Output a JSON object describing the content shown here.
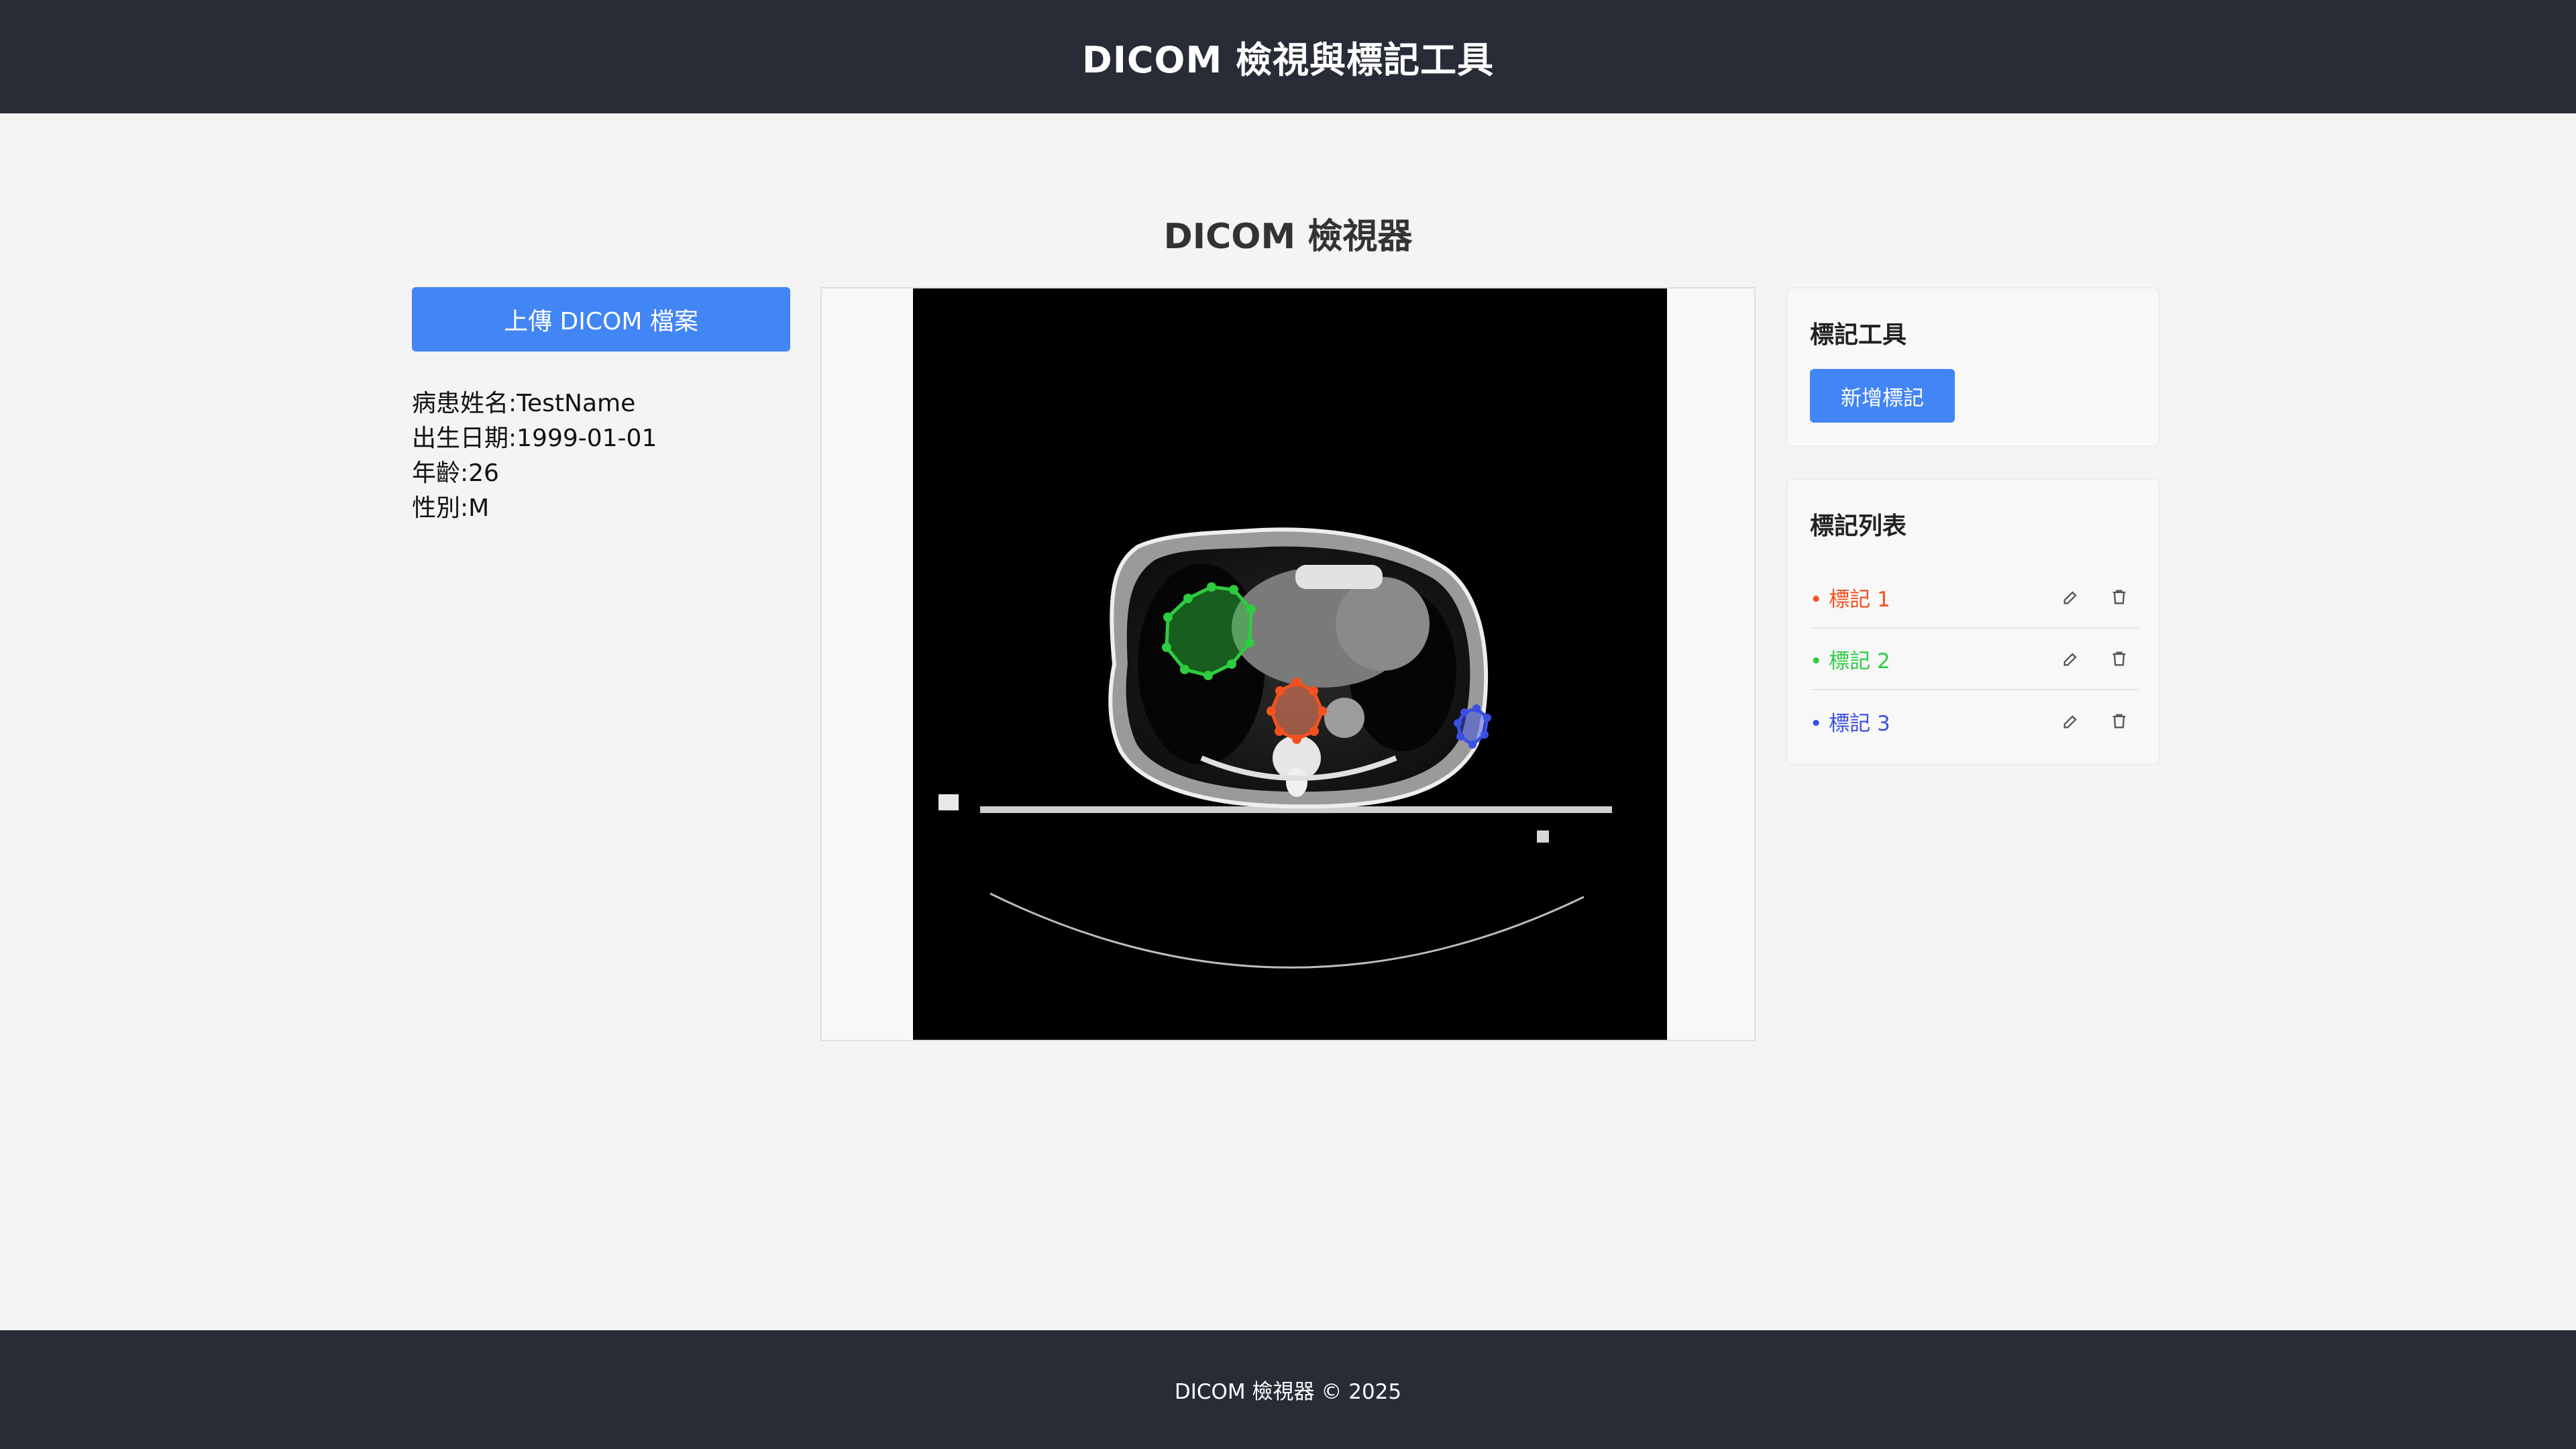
{
  "header": {
    "title": "DICOM 檢視與標記工具"
  },
  "viewer": {
    "heading": "DICOM 檢視器"
  },
  "upload": {
    "label": "上傳 DICOM 檔案"
  },
  "patient": {
    "name": "病患姓名:TestName",
    "birth_date": "出生日期:1999-01-01",
    "age": "年齡:26",
    "sex": "性別:M"
  },
  "tools": {
    "title": "標記工具",
    "add_label": "新增標記"
  },
  "annotations": {
    "title": "標記列表",
    "items": [
      {
        "label": "• 標記 1",
        "color": "#f4511e"
      },
      {
        "label": "• 標記 2",
        "color": "#2ecc40"
      },
      {
        "label": "• 標記 3",
        "color": "#3b4fe4"
      }
    ]
  },
  "icons": {
    "edit": "edit-icon",
    "delete": "trash-icon"
  },
  "colors": {
    "accent": "#4285f4",
    "header_bg": "#282c37"
  },
  "footer": {
    "text": "DICOM 檢視器 © 2025"
  }
}
